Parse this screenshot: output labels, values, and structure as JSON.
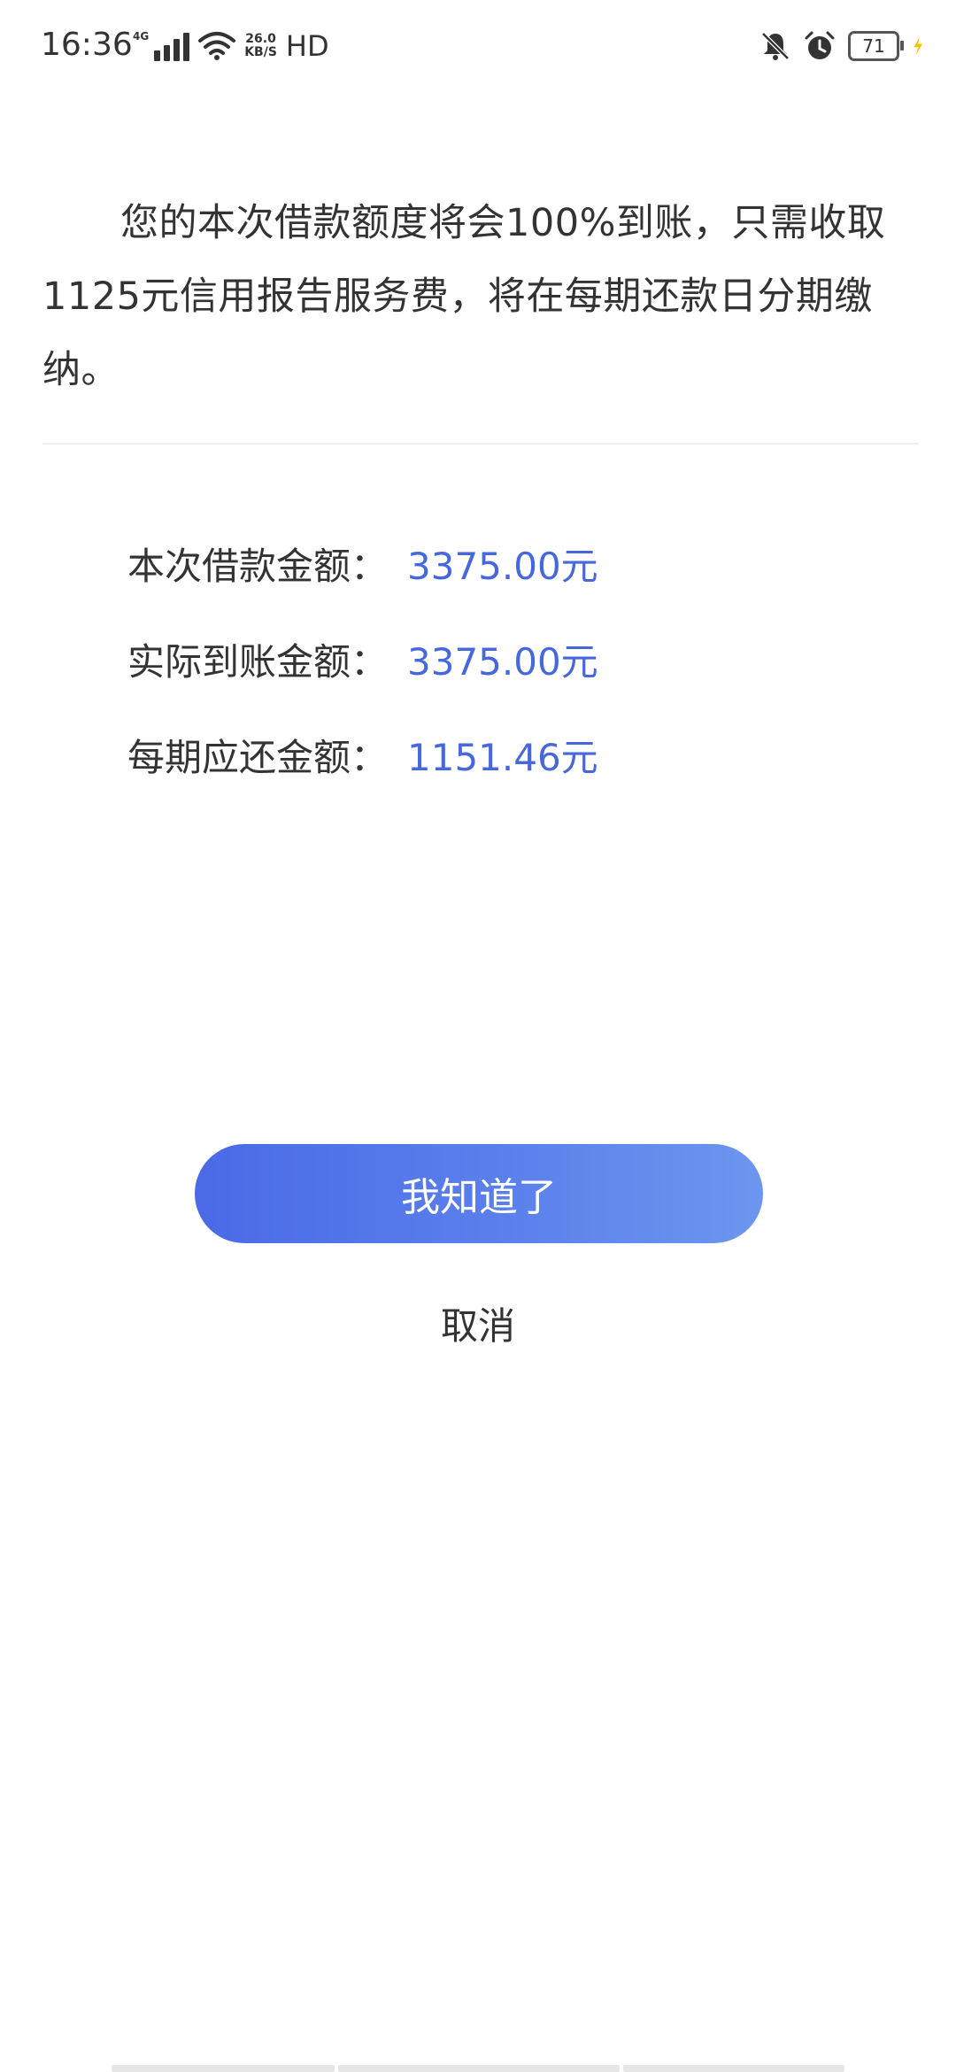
{
  "status_bar": {
    "time": "16:36",
    "network": "4G",
    "speed_value": "26.0",
    "speed_unit": "KB/S",
    "hd": "HD",
    "battery": "71",
    "charging_color": "#f5c400",
    "icons": [
      "signal-icon",
      "wifi-icon",
      "mute-notification-icon",
      "alarm-icon",
      "battery-icon",
      "charging-icon"
    ]
  },
  "notice": {
    "text": "您的本次借款额度将会100%到账，只需收取1125元信用报告服务费，将在每期还款日分期缴纳。"
  },
  "details": [
    {
      "label": "本次借款金额：",
      "value": "3375.00元"
    },
    {
      "label": "实际到账金额：",
      "value": "3375.00元"
    },
    {
      "label": "每期应还金额：",
      "value": "1151.46元"
    }
  ],
  "actions": {
    "confirm": "我知道了",
    "cancel": "取消"
  },
  "colors": {
    "accent": "#4668dc",
    "button_gradient_start": "#4a6ae6",
    "button_gradient_end": "#6c96ee"
  }
}
